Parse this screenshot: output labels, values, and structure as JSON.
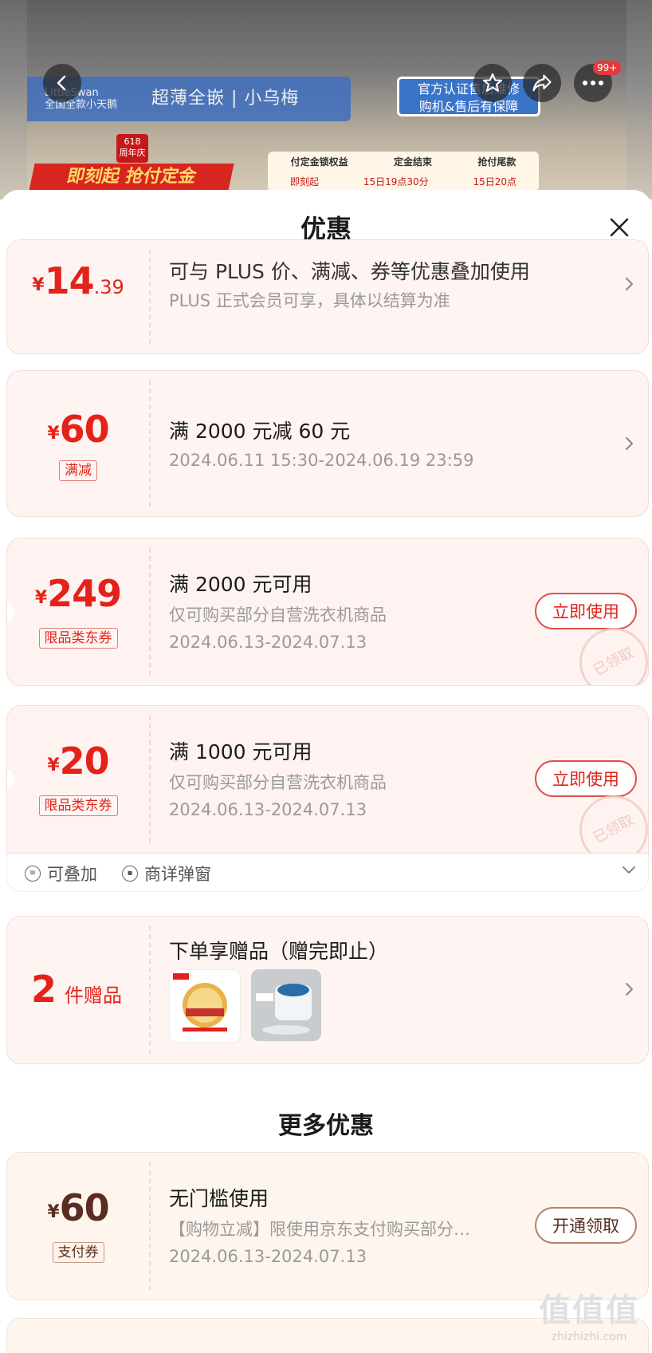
{
  "hero": {
    "brand_logo": "LittleSwan\n全国全款小天鹅",
    "brand_text": "超薄全嵌 | 小乌梅",
    "official_badge": "官方认证售后维修\n购机&售后有保障",
    "badge_618": "618\n周年庆",
    "promo_text": "即刻起 抢付定金",
    "deposit_bar": {
      "row1": [
        "付定金锁权益",
        "定金结束",
        "抢付尾款"
      ],
      "row2": [
        "即刻起",
        "15日19点30分",
        "15日20点"
      ]
    },
    "message_badge": "99+",
    "icons": [
      "back-icon",
      "star-icon",
      "share-icon",
      "more-icon"
    ]
  },
  "sheet": {
    "title": "优惠",
    "close_icon": "close-icon"
  },
  "coupons": [
    {
      "amount_yen": "¥",
      "amount_int": "14",
      "amount_cents": ".39",
      "title": "可与 PLUS 价、满减、券等优惠叠加使用",
      "subtitle": "PLUS 正式会员可享，具体以结算为准"
    },
    {
      "amount_yen": "¥",
      "amount_int": "60",
      "tag": "满减",
      "title": "满 2000 元减 60 元",
      "subtitle": "2024.06.11 15:30-2024.06.19 23:59"
    },
    {
      "amount_yen": "¥",
      "amount_int": "249",
      "tag": "限品类东券",
      "title": "满 2000 元可用",
      "subtitle": "仅可购买部分自营洗衣机商品",
      "date": "2024.06.13-2024.07.13",
      "button": "立即使用",
      "stamp": "已领取"
    },
    {
      "amount_yen": "¥",
      "amount_int": "20",
      "tag": "限品类东券",
      "title": "满 1000 元可用",
      "subtitle": "仅可购买部分自营洗衣机商品",
      "date": "2024.06.13-2024.07.13",
      "button": "立即使用",
      "stamp": "已领取"
    }
  ],
  "coupon_footer": {
    "tag1": "可叠加",
    "tag2": "商详弹窗"
  },
  "gifts": {
    "count": "2",
    "count_label": "件赠品",
    "title": "下单享赠品（赠完即止）"
  },
  "more_section": {
    "title": "更多优惠",
    "card": {
      "amount_yen": "¥",
      "amount_int": "60",
      "tag": "支付券",
      "title": "无门槛使用",
      "subtitle": "【购物立减】限使用京东支付购买部分…",
      "date": "2024.06.13-2024.07.13",
      "button": "开通领取"
    }
  },
  "watermark": {
    "big": "值值值",
    "small": "zhizhizhi.com"
  }
}
